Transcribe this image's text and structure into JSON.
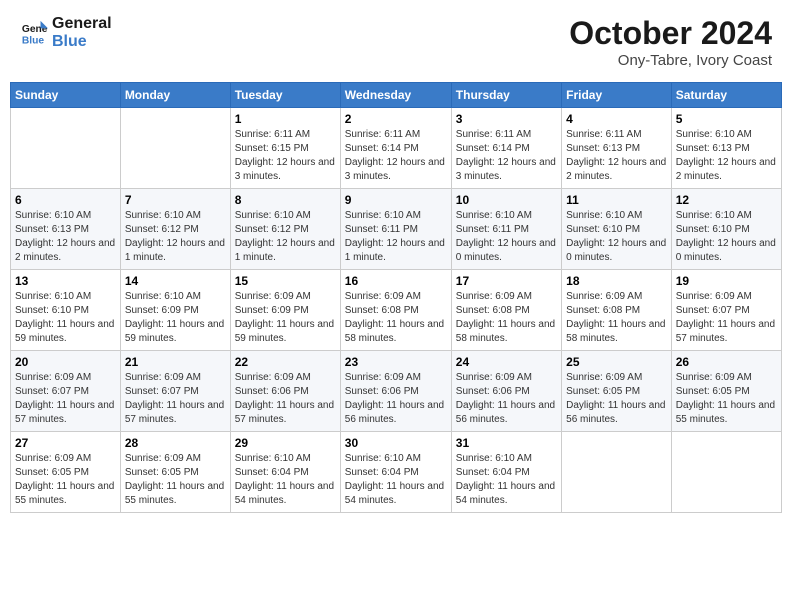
{
  "logo": {
    "line1": "General",
    "line2": "Blue"
  },
  "title": "October 2024",
  "subtitle": "Ony-Tabre, Ivory Coast",
  "days_header": [
    "Sunday",
    "Monday",
    "Tuesday",
    "Wednesday",
    "Thursday",
    "Friday",
    "Saturday"
  ],
  "weeks": [
    [
      {
        "day": "",
        "info": ""
      },
      {
        "day": "",
        "info": ""
      },
      {
        "day": "1",
        "info": "Sunrise: 6:11 AM\nSunset: 6:15 PM\nDaylight: 12 hours and 3 minutes."
      },
      {
        "day": "2",
        "info": "Sunrise: 6:11 AM\nSunset: 6:14 PM\nDaylight: 12 hours and 3 minutes."
      },
      {
        "day": "3",
        "info": "Sunrise: 6:11 AM\nSunset: 6:14 PM\nDaylight: 12 hours and 3 minutes."
      },
      {
        "day": "4",
        "info": "Sunrise: 6:11 AM\nSunset: 6:13 PM\nDaylight: 12 hours and 2 minutes."
      },
      {
        "day": "5",
        "info": "Sunrise: 6:10 AM\nSunset: 6:13 PM\nDaylight: 12 hours and 2 minutes."
      }
    ],
    [
      {
        "day": "6",
        "info": "Sunrise: 6:10 AM\nSunset: 6:13 PM\nDaylight: 12 hours and 2 minutes."
      },
      {
        "day": "7",
        "info": "Sunrise: 6:10 AM\nSunset: 6:12 PM\nDaylight: 12 hours and 1 minute."
      },
      {
        "day": "8",
        "info": "Sunrise: 6:10 AM\nSunset: 6:12 PM\nDaylight: 12 hours and 1 minute."
      },
      {
        "day": "9",
        "info": "Sunrise: 6:10 AM\nSunset: 6:11 PM\nDaylight: 12 hours and 1 minute."
      },
      {
        "day": "10",
        "info": "Sunrise: 6:10 AM\nSunset: 6:11 PM\nDaylight: 12 hours and 0 minutes."
      },
      {
        "day": "11",
        "info": "Sunrise: 6:10 AM\nSunset: 6:10 PM\nDaylight: 12 hours and 0 minutes."
      },
      {
        "day": "12",
        "info": "Sunrise: 6:10 AM\nSunset: 6:10 PM\nDaylight: 12 hours and 0 minutes."
      }
    ],
    [
      {
        "day": "13",
        "info": "Sunrise: 6:10 AM\nSunset: 6:10 PM\nDaylight: 11 hours and 59 minutes."
      },
      {
        "day": "14",
        "info": "Sunrise: 6:10 AM\nSunset: 6:09 PM\nDaylight: 11 hours and 59 minutes."
      },
      {
        "day": "15",
        "info": "Sunrise: 6:09 AM\nSunset: 6:09 PM\nDaylight: 11 hours and 59 minutes."
      },
      {
        "day": "16",
        "info": "Sunrise: 6:09 AM\nSunset: 6:08 PM\nDaylight: 11 hours and 58 minutes."
      },
      {
        "day": "17",
        "info": "Sunrise: 6:09 AM\nSunset: 6:08 PM\nDaylight: 11 hours and 58 minutes."
      },
      {
        "day": "18",
        "info": "Sunrise: 6:09 AM\nSunset: 6:08 PM\nDaylight: 11 hours and 58 minutes."
      },
      {
        "day": "19",
        "info": "Sunrise: 6:09 AM\nSunset: 6:07 PM\nDaylight: 11 hours and 57 minutes."
      }
    ],
    [
      {
        "day": "20",
        "info": "Sunrise: 6:09 AM\nSunset: 6:07 PM\nDaylight: 11 hours and 57 minutes."
      },
      {
        "day": "21",
        "info": "Sunrise: 6:09 AM\nSunset: 6:07 PM\nDaylight: 11 hours and 57 minutes."
      },
      {
        "day": "22",
        "info": "Sunrise: 6:09 AM\nSunset: 6:06 PM\nDaylight: 11 hours and 57 minutes."
      },
      {
        "day": "23",
        "info": "Sunrise: 6:09 AM\nSunset: 6:06 PM\nDaylight: 11 hours and 56 minutes."
      },
      {
        "day": "24",
        "info": "Sunrise: 6:09 AM\nSunset: 6:06 PM\nDaylight: 11 hours and 56 minutes."
      },
      {
        "day": "25",
        "info": "Sunrise: 6:09 AM\nSunset: 6:05 PM\nDaylight: 11 hours and 56 minutes."
      },
      {
        "day": "26",
        "info": "Sunrise: 6:09 AM\nSunset: 6:05 PM\nDaylight: 11 hours and 55 minutes."
      }
    ],
    [
      {
        "day": "27",
        "info": "Sunrise: 6:09 AM\nSunset: 6:05 PM\nDaylight: 11 hours and 55 minutes."
      },
      {
        "day": "28",
        "info": "Sunrise: 6:09 AM\nSunset: 6:05 PM\nDaylight: 11 hours and 55 minutes."
      },
      {
        "day": "29",
        "info": "Sunrise: 6:10 AM\nSunset: 6:04 PM\nDaylight: 11 hours and 54 minutes."
      },
      {
        "day": "30",
        "info": "Sunrise: 6:10 AM\nSunset: 6:04 PM\nDaylight: 11 hours and 54 minutes."
      },
      {
        "day": "31",
        "info": "Sunrise: 6:10 AM\nSunset: 6:04 PM\nDaylight: 11 hours and 54 minutes."
      },
      {
        "day": "",
        "info": ""
      },
      {
        "day": "",
        "info": ""
      }
    ]
  ]
}
